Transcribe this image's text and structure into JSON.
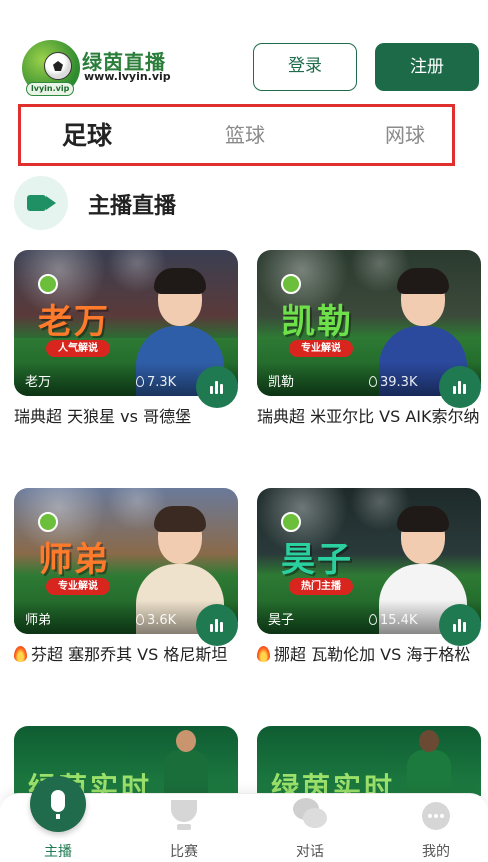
{
  "header": {
    "logo_name": "绿茵直播",
    "logo_url": "www.lvyin.vip",
    "logo_badge": "lvyin.vip",
    "login_label": "登录",
    "register_label": "注册"
  },
  "sport_tabs": [
    {
      "label": "足球",
      "active": true
    },
    {
      "label": "篮球",
      "active": false
    },
    {
      "label": "网球",
      "active": false
    }
  ],
  "section": {
    "title": "主播直播",
    "icon": "video-camera-icon"
  },
  "streams": [
    {
      "big_name": "老万",
      "tag": "人气解说",
      "anchor": "老万",
      "heat": "7.3K",
      "title": "瑞典超  天狼星 vs 哥德堡",
      "hot": false,
      "name_color": "#ff7a2a",
      "shirt_color": "#2f5ea8"
    },
    {
      "big_name": "凯勒",
      "tag": "专业解说",
      "anchor": "凯勒",
      "heat": "39.3K",
      "title": "瑞典超 米亚尔比 VS AIK索尔纳",
      "hot": false,
      "name_color": "#6ee04a",
      "shirt_color": "#2b4a9e"
    },
    {
      "big_name": "师弟",
      "tag": "专业解说",
      "anchor": "师弟",
      "heat": "3.6K",
      "title": "芬超  塞那乔其 VS 格尼斯坦",
      "hot": true,
      "name_color": "#ff7a2a",
      "shirt_color": "#f3e6d0"
    },
    {
      "big_name": "昊子",
      "tag": "热门主播",
      "anchor": "昊子",
      "heat": "15.4K",
      "title": "挪超  瓦勒伦加 VS 海于格松",
      "hot": true,
      "name_color": "#2bd0a0",
      "shirt_color": "#f4f4f4"
    }
  ],
  "teasers": [
    {
      "text": "绿茵实时",
      "kit_color": "#1a6e3a"
    },
    {
      "text": "绿茵实时",
      "kit_color": "#1d7a3e"
    }
  ],
  "bottom_nav": [
    {
      "label": "主播",
      "icon": "microphone-icon",
      "active": true
    },
    {
      "label": "比赛",
      "icon": "trophy-icon",
      "active": false
    },
    {
      "label": "对话",
      "icon": "chat-bubbles-icon",
      "active": false
    },
    {
      "label": "我的",
      "icon": "more-dots-icon",
      "active": false
    }
  ],
  "colors": {
    "brand_green": "#1d6a49",
    "tab_highlight": "#e0302e",
    "live_badge": "#1f7a52"
  }
}
